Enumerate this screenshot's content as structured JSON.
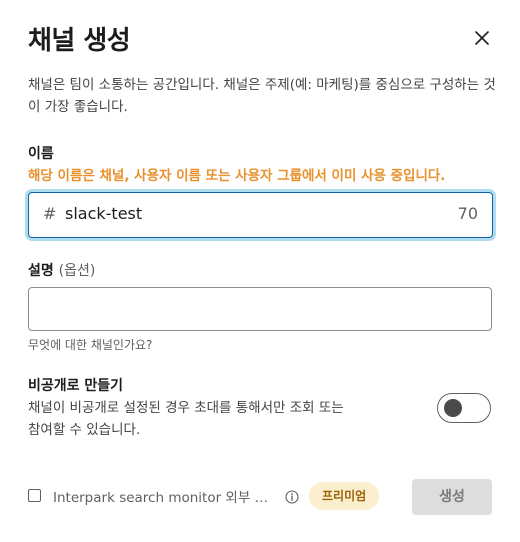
{
  "dialog": {
    "title": "채널 생성",
    "description": "채널은 팀이 소통하는 공간입니다. 채널은 주제(예: 마케팅)를 중심으로 구성하는 것이 가장 좋습니다.",
    "close_icon": "close-icon"
  },
  "name_field": {
    "label": "이름",
    "error": "해당 이름은 채널, 사용자 이름 또는 사용자 그룹에서 이미 사용 중입니다.",
    "prefix": "#",
    "value": "slack-test",
    "remaining_chars": "70"
  },
  "description_field": {
    "label": "설명",
    "optional_label": "(옵션)",
    "value": "",
    "hint": "무엇에 대한 채널인가요?"
  },
  "private": {
    "label": "비공개로 만들기",
    "description": "채널이 비공개로 설정된 경우 초대를 통해서만 조회 또는 참여할 수 있습니다.",
    "enabled": false
  },
  "footer": {
    "share_checkbox_label": "Interpark search monitor 외부 공...",
    "info_icon": "info-icon",
    "premium_badge": "프리미엄",
    "create_button": "생성"
  },
  "colors": {
    "error": "#e8912d",
    "focus_border": "#1264a3",
    "premium_bg": "#fcefcf",
    "premium_text": "#9a6305",
    "button_disabled_bg": "#dddddd"
  }
}
